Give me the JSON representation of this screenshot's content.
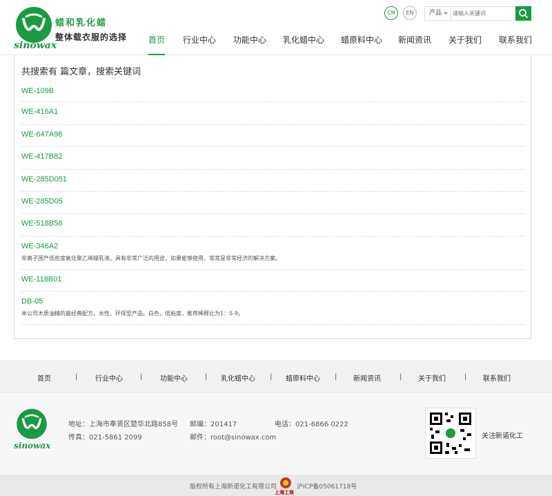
{
  "header": {
    "logo_text": "sinowax",
    "slogan_line1": "蜡和乳化蜡",
    "slogan_line2": "整体载衣服的选择",
    "lang_cn": "CN",
    "lang_en": "EN",
    "search_select": "产品",
    "search_placeholder": "请输入关键词"
  },
  "nav": [
    {
      "label": "首页",
      "active": true
    },
    {
      "label": "行业中心"
    },
    {
      "label": "功能中心"
    },
    {
      "label": "乳化蜡中心"
    },
    {
      "label": "蜡原料中心"
    },
    {
      "label": "新闻资讯"
    },
    {
      "label": "关于我们"
    },
    {
      "label": "联系我们"
    }
  ],
  "main": {
    "result_title": "共搜索有 篇文章，搜索关键词",
    "items": [
      {
        "name": "WE-109B",
        "desc": ""
      },
      {
        "name": "WE-416A1",
        "desc": ""
      },
      {
        "name": "WE-647A98",
        "desc": ""
      },
      {
        "name": "WE-417B82",
        "desc": ""
      },
      {
        "name": "WE-285D051",
        "desc": ""
      },
      {
        "name": "WE-285D05",
        "desc": ""
      },
      {
        "name": "WE-518B58",
        "desc": ""
      },
      {
        "name": "WE-346A2",
        "desc": "非离子国产低密度氧化聚乙烯蜡乳液。具有非常广泛的用途，如果能够使用，常常是非常经济的解决方案。"
      },
      {
        "name": "WE-118B01",
        "desc": ""
      },
      {
        "name": "DB-05",
        "desc": "本公司木质油精的最经典配方。水性、环保型产品。白色，低粘度，推荐稀释比为1：5-9。"
      }
    ]
  },
  "footer_nav": [
    "首页",
    "行业中心",
    "功能中心",
    "乳化蜡中心",
    "蜡原料中心",
    "新闻资讯",
    "关于我们",
    "联系我们"
  ],
  "footer_nav_separator": "|",
  "footer": {
    "logo_text": "sinowax",
    "address": "地址：上海市奉贤区楚华北路858号",
    "postcode": "邮编：201417",
    "phone": "电话：021-6866 0222",
    "fax": "传真：021-5861 2099",
    "email": "邮件：root@sinowax.com",
    "follow": "关注新诺化工",
    "copyright": "版权所有上海新诺化工有限公司",
    "icp": "沪ICP备05061718号",
    "badge_text": "上海工商"
  },
  "colors": {
    "brand_green": "#1a9a41"
  }
}
